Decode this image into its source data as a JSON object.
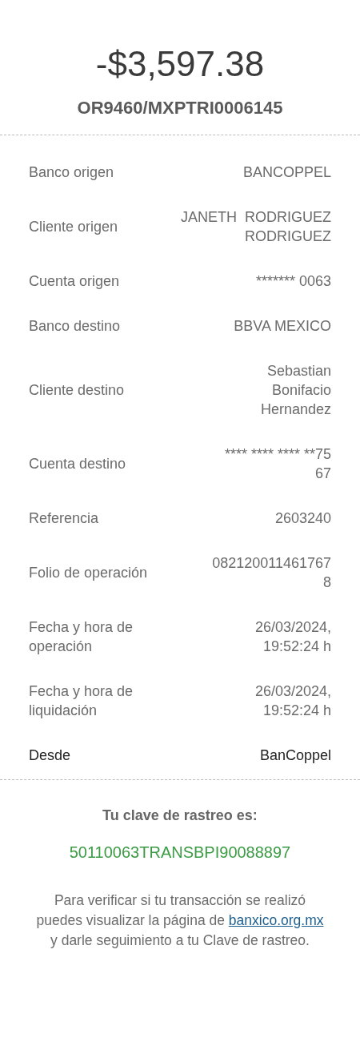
{
  "amount": "-$3,597.38",
  "reference": "OR9460/MXPTRI0006145",
  "details": [
    {
      "kind": "detail",
      "label": "Banco origen",
      "value": "BANCOPPEL"
    },
    {
      "kind": "detail",
      "label": "Cliente origen",
      "value": "JANETH  RODRIGUEZ\nRODRIGUEZ"
    },
    {
      "kind": "detail",
      "label": "Cuenta origen",
      "value": "******* 0063"
    },
    {
      "kind": "detail",
      "label": "Banco destino",
      "value": "BBVA MEXICO"
    },
    {
      "kind": "detail",
      "label": "Cliente destino",
      "value": "Sebastian\nBonifacio\nHernandez"
    },
    {
      "kind": "detail",
      "label": "Cuenta destino",
      "value": "**** **** **** **75\n67"
    },
    {
      "kind": "detail",
      "label": "Referencia",
      "value": "2603240"
    },
    {
      "kind": "detail",
      "label": "Folio de operación",
      "value": "082120011461767\n8"
    },
    {
      "kind": "detail",
      "label": "Fecha y hora de\noperación",
      "value": "26/03/2024,\n19:52:24 h"
    },
    {
      "kind": "detail",
      "label": "Fecha y hora de\nliquidación",
      "value": "26/03/2024,\n19:52:24 h"
    },
    {
      "kind": "emphasis",
      "label": "Desde",
      "value": "BanCoppel"
    }
  ],
  "tracking": {
    "title": "Tu clave de rastreo es:",
    "code": "50110063TRANSBPI90088897"
  },
  "note": {
    "before": "Para verificar si tu transacción se realizó\npuedes visualizar la página de ",
    "link": "banxico.org.mx",
    "after": "\ny darle seguimiento a tu Clave de rastreo."
  }
}
